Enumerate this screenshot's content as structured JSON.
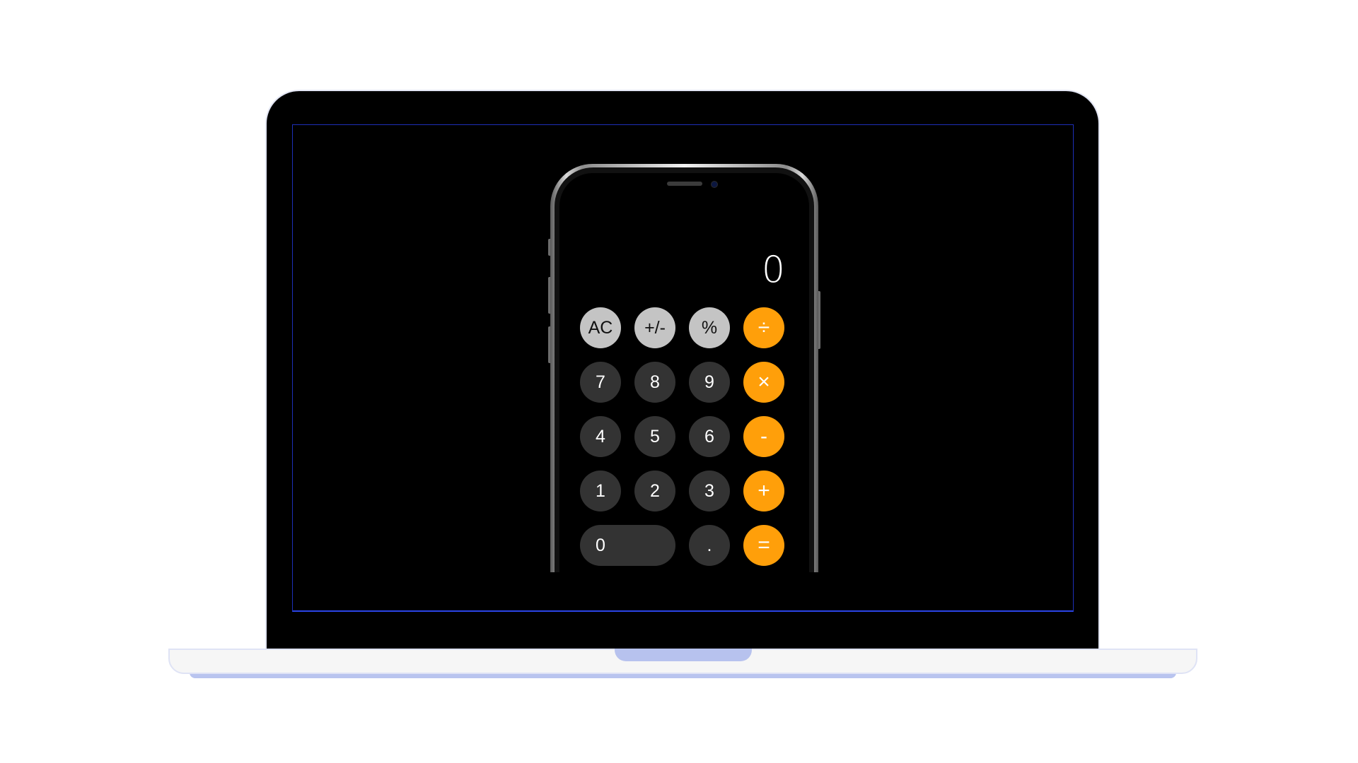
{
  "calculator": {
    "display": "0",
    "rows": [
      [
        {
          "label": "AC",
          "kind": "func"
        },
        {
          "label": "+/-",
          "kind": "func"
        },
        {
          "label": "%",
          "kind": "func"
        },
        {
          "label": "÷",
          "kind": "op"
        }
      ],
      [
        {
          "label": "7",
          "kind": "num"
        },
        {
          "label": "8",
          "kind": "num"
        },
        {
          "label": "9",
          "kind": "num"
        },
        {
          "label": "×",
          "kind": "op"
        }
      ],
      [
        {
          "label": "4",
          "kind": "num"
        },
        {
          "label": "5",
          "kind": "num"
        },
        {
          "label": "6",
          "kind": "num"
        },
        {
          "label": "-",
          "kind": "op"
        }
      ],
      [
        {
          "label": "1",
          "kind": "num"
        },
        {
          "label": "2",
          "kind": "num"
        },
        {
          "label": "3",
          "kind": "num"
        },
        {
          "label": "+",
          "kind": "op"
        }
      ],
      [
        {
          "label": "0",
          "kind": "num"
        },
        {
          "label": ".",
          "kind": "num"
        },
        {
          "label": "=",
          "kind": "op"
        }
      ]
    ]
  },
  "colors": {
    "operator": "#ff9f0a",
    "function": "#c4c4c4",
    "number": "#333333",
    "display_text": "#ffffff",
    "screen_border": "#2b44e6"
  }
}
